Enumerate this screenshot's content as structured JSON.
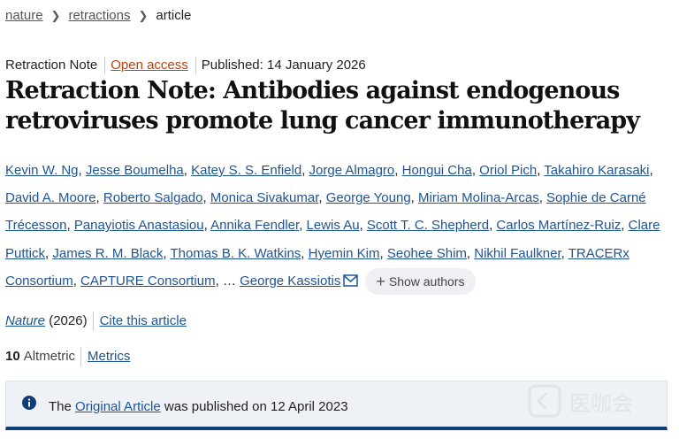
{
  "breadcrumb": {
    "items": [
      "nature",
      "retractions"
    ],
    "current": "article"
  },
  "meta": {
    "type": "Retraction Note",
    "access": "Open access",
    "published": "Published: 14 January 2026"
  },
  "title": "Retraction Note: Antibodies against endogenous retroviruses promote lung cancer immunotherapy",
  "authors": [
    "Kevin W. Ng",
    "Jesse Boumelha",
    "Katey S. S. Enfield",
    "Jorge Almagro",
    "Hongui Cha",
    "Oriol Pich",
    "Takahiro Karasaki",
    "David A. Moore",
    "Roberto Salgado",
    "Monica Sivakumar",
    "George Young",
    "Miriam Molina-Arcas",
    "Sophie de Carné Trécesson",
    "Panayiotis Anastasiou",
    "Annika Fendler",
    "Lewis Au",
    "Scott T. C. Shepherd",
    "Carlos Martínez-Ruiz",
    "Clare Puttick",
    "James R. M. Black",
    "Thomas B. K. Watkins",
    "Hyemin Kim",
    "Seohee Shim",
    "Nikhil Faulkner",
    "TRACERx Consortium",
    "CAPTURE Consortium"
  ],
  "authors_ellipsis": "…",
  "last_author": "George Kassiotis",
  "show_authors_label": "Show authors",
  "journal": {
    "name": "Nature",
    "year": "(2026)",
    "cite_label": "Cite this article"
  },
  "metrics": {
    "altmetric_value": "10",
    "altmetric_label": "Altmetric",
    "metrics_link": "Metrics"
  },
  "notice": {
    "prefix": "The",
    "link": "Original Article",
    "suffix": "was published on 12 April 2023"
  },
  "watermark": {
    "text": "医咖会"
  },
  "colors": {
    "link": "#1e5496",
    "open_access": "#c2410c",
    "notice_border": "#0f3d7a",
    "notice_bg": "#eef1f5"
  }
}
